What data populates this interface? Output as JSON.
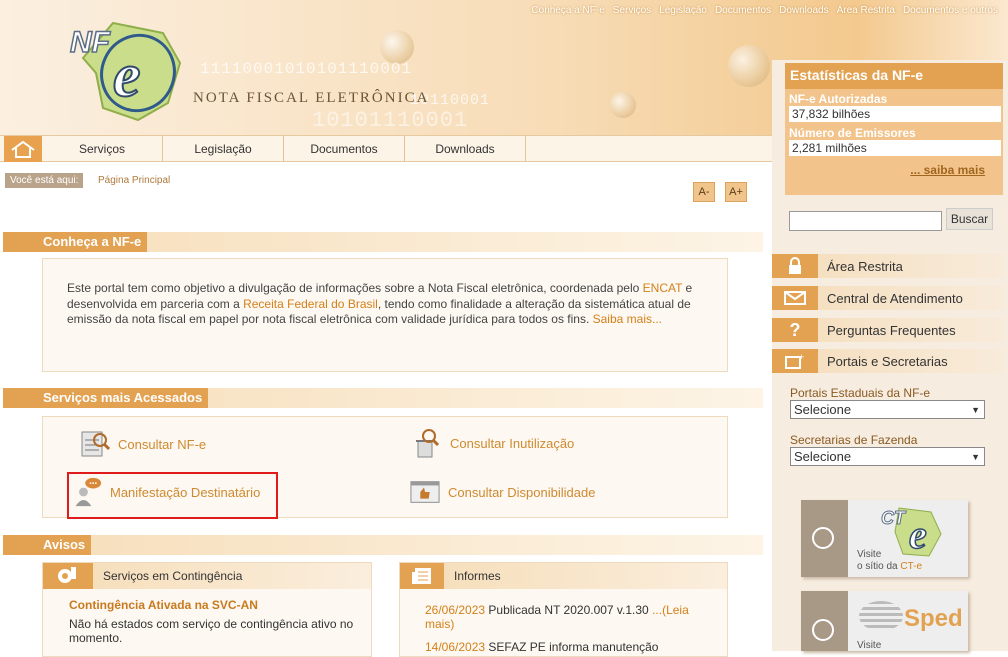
{
  "top_links": [
    "Conheça a NF-e",
    "Serviços",
    "Legislação",
    "Documentos",
    "Downloads",
    "Área Restrita",
    "Documentos e outros"
  ],
  "header": {
    "logo_text": "NF-e",
    "title": "NOTA FISCAL ELETRÔNICA",
    "binary": [
      "11110001010101110001",
      "10110001",
      "10101110001"
    ]
  },
  "nav": {
    "items": [
      "Serviços",
      "Legislação",
      "Documentos",
      "Downloads"
    ]
  },
  "breadcrumb": {
    "label": "Você está aqui:",
    "current": "Página Principal"
  },
  "font_controls": {
    "decrease": "A-",
    "increase": "A+"
  },
  "intro": {
    "title": "Conheça a NF-e",
    "text1": "Este portal tem como objetivo a divulgação de informações sobre a Nota Fiscal eletrônica, coordenada pelo ",
    "link1": "ENCAT",
    "text2": " e desenvolvida em parceria com a ",
    "link2": "Receita Federal do Brasil",
    "text3": ", tendo como finalidade a alteração da sistemática atual de emissão da nota fiscal em papel por nota fiscal eletrônica com validade jurídica para todos os fins. ",
    "link3": "Saiba mais..."
  },
  "services": {
    "title": "Serviços mais Acessados",
    "items": [
      "Consultar NF-e",
      "Consultar Inutilização",
      "Manifestação Destinatário",
      "Consultar Disponibilidade"
    ]
  },
  "avisos": {
    "title": "Avisos",
    "contingencia": {
      "header": "Serviços em Contingência",
      "title": "Contingência Ativada na SVC-AN",
      "text": "Não há estados com serviço de contingência ativo no momento."
    },
    "informes": {
      "header": "Informes",
      "items": [
        {
          "date": "26/06/2023",
          "text": " Publicada NT 2020.007 v.1.30 ",
          "link": "...(Leia mais)"
        },
        {
          "date": "14/06/2023",
          "text": " SEFAZ PE informa manutenção"
        }
      ]
    }
  },
  "stats": {
    "title": "Estatísticas da NF-e",
    "authorized_label": "NF-e Autorizadas",
    "authorized_value": "37,832 bilhões",
    "issuers_label": "Número de Emissores",
    "issuers_value": "2,281 milhões",
    "more": "... saiba mais"
  },
  "search": {
    "button": "Buscar",
    "value": ""
  },
  "sidebar": {
    "items": [
      "Área Restrita",
      "Central de Atendimento",
      "Perguntas Frequentes",
      "Portais e Secretarias"
    ],
    "portais_label": "Portais Estaduais da NF-e",
    "portais_value": "Selecione",
    "secretarias_label": "Secretarias de Fazenda",
    "secretarias_value": "Selecione"
  },
  "banners": {
    "cte_logo": "CT-e",
    "cte_text1": "Visite",
    "cte_text2": "o sítio da ",
    "cte_link": "CT-e",
    "sped_logo": "Sped",
    "sped_text1": "Visite"
  },
  "colors": {
    "accent": "#e3a252",
    "link": "#d4801a",
    "highlight": "#e01b1b"
  }
}
